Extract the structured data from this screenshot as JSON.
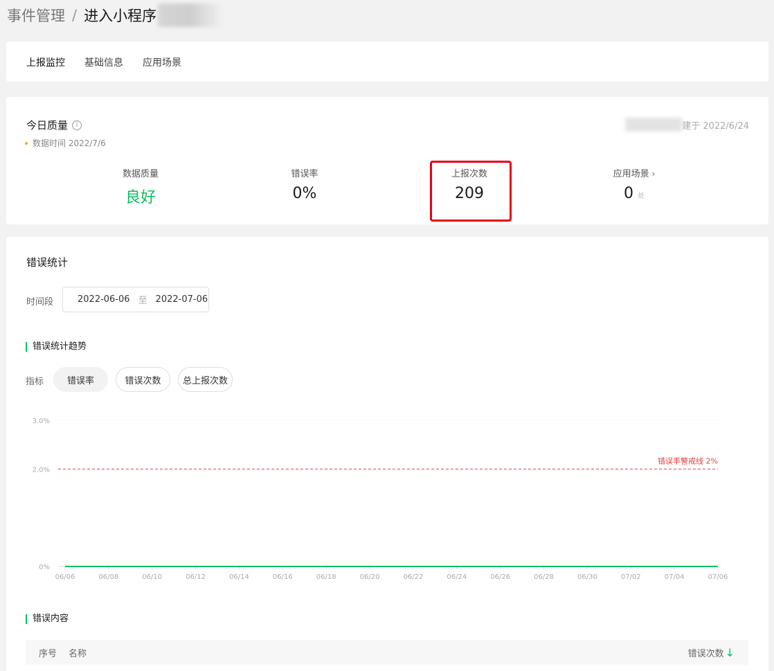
{
  "breadcrumb": {
    "parent": "事件管理",
    "separator": "/",
    "current": "进入小程序"
  },
  "tabs": [
    {
      "label": "上报监控"
    },
    {
      "label": "基础信息"
    },
    {
      "label": "应用场景"
    }
  ],
  "quality": {
    "title": "今日质量",
    "data_time": "数据时间 2022/7/6",
    "right_text": "建于 2022/6/24",
    "metrics": [
      {
        "label": "数据质量",
        "value": "良好"
      },
      {
        "label": "错误率",
        "value": "0%"
      },
      {
        "label": "上报次数",
        "value": "209"
      },
      {
        "label": "应用场景",
        "value": "0",
        "unit": "处"
      }
    ]
  },
  "stats": {
    "title": "错误统计",
    "period_label": "时间段",
    "date_start": "2022-06-06",
    "date_to": "至",
    "date_end": "2022-07-06",
    "trend_title": "错误统计趋势",
    "metric_label": "指标",
    "metric_options": [
      {
        "label": "错误率"
      },
      {
        "label": "错误次数"
      },
      {
        "label": "总上报次数"
      }
    ],
    "content_title": "错误内容",
    "table_columns": {
      "index": "序号",
      "name": "名称",
      "count": "错误次数"
    }
  },
  "chart_data": {
    "type": "line",
    "x": [
      "06/06",
      "06/08",
      "06/10",
      "06/12",
      "06/14",
      "06/16",
      "06/18",
      "06/20",
      "06/22",
      "06/24",
      "06/26",
      "06/28",
      "06/30",
      "07/02",
      "07/04",
      "07/06"
    ],
    "y_ticks": [
      "3.0%",
      "2.0%",
      "0%"
    ],
    "ylim": [
      0,
      3
    ],
    "series": [
      {
        "values": [
          0,
          0,
          0,
          0,
          0,
          0,
          0,
          0,
          0,
          0,
          0,
          0,
          0,
          0,
          0,
          0
        ],
        "color": "#07c160"
      }
    ],
    "threshold": {
      "value": 2,
      "label": "错误率警戒线 2%",
      "color": "#e64340"
    },
    "colors": {
      "grid": "#ececec",
      "axis": "#d9d9d9",
      "tick": "#aaaaaa"
    }
  }
}
